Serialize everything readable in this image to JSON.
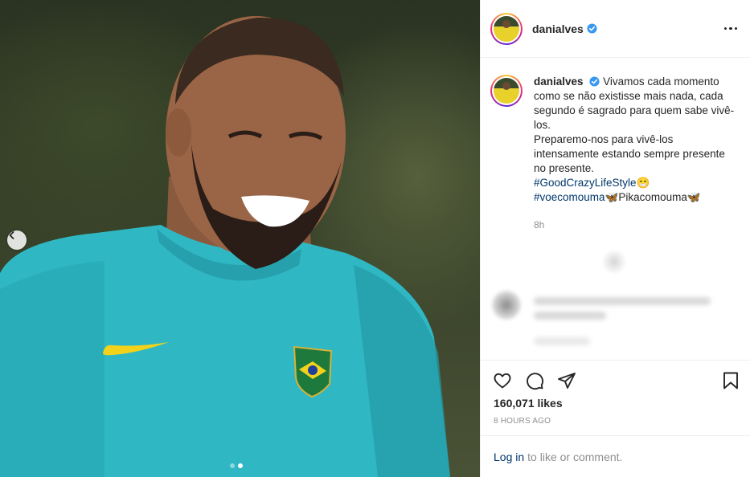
{
  "post": {
    "username": "danialves",
    "caption": {
      "line1": "Vivamos cada momento como se não existisse mais nada, cada segundo é sagrado para quem sabe vivê-los.",
      "line2": "Preparemo-nos para vivê-los intensamente estando sempre presente no presente.",
      "hashtag1": "#GoodCrazyLifeStyle",
      "emoji1": "😁",
      "hashtag2": "#voecomouma",
      "emoji2": "🦋",
      "suffix": "Pikacomouma",
      "emoji3": "🦋"
    },
    "timestamp": "8h",
    "likes": "160,071 likes",
    "posted_ago": "8 HOURS AGO"
  },
  "comment_bar": {
    "login_label": "Log in",
    "rest_text": "to like or comment."
  },
  "carousel": {
    "slide_count": 2,
    "active_index": 1
  },
  "icons": {
    "prev": "chevron-left-icon",
    "verified": "verified-badge-icon",
    "more": "more-options-icon",
    "like": "heart-icon",
    "comment": "comment-icon",
    "share": "share-icon",
    "save": "bookmark-icon"
  },
  "colors": {
    "verified": "#3897f0",
    "link": "#00376b",
    "jersey": "#2fb8c4",
    "muted": "#8e8e8e"
  }
}
